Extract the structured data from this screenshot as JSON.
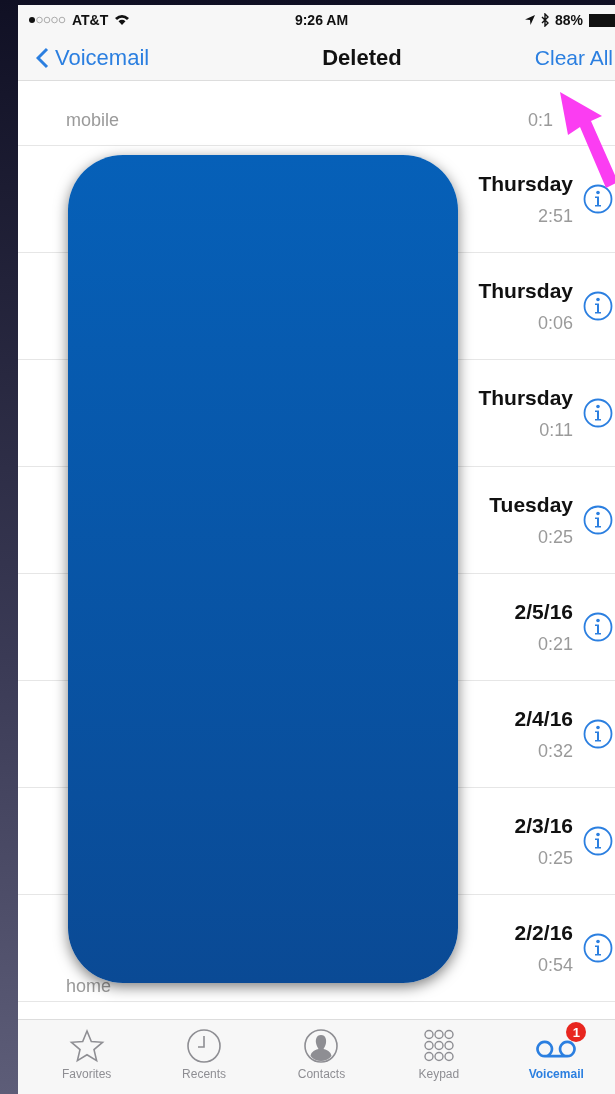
{
  "status_bar": {
    "carrier": "AT&T",
    "time": "9:26 AM",
    "battery": "88%"
  },
  "nav": {
    "back": "Voicemail",
    "title": "Deleted",
    "action": "Clear All"
  },
  "rows": [
    {
      "subtitle": "mobile",
      "duration": "0:1"
    },
    {
      "date": "Thursday",
      "duration": "2:51"
    },
    {
      "date": "Thursday",
      "duration": "0:06"
    },
    {
      "date": "Thursday",
      "duration": "0:11"
    },
    {
      "date": "Tuesday",
      "duration": "0:25"
    },
    {
      "date": "2/5/16",
      "duration": "0:21"
    },
    {
      "date": "2/4/16",
      "duration": "0:32"
    },
    {
      "date": "2/3/16",
      "duration": "0:25"
    },
    {
      "subtitle": "home",
      "date": "2/2/16",
      "duration": "0:54"
    }
  ],
  "tabs": [
    {
      "kind": "star",
      "label": "Favorites",
      "selected": false
    },
    {
      "kind": "clock",
      "label": "Recents",
      "selected": false
    },
    {
      "kind": "person",
      "label": "Contacts",
      "selected": false
    },
    {
      "kind": "keypad",
      "label": "Keypad",
      "selected": false
    },
    {
      "kind": "voicemail",
      "label": "Voicemail",
      "selected": true,
      "badge": "1"
    }
  ]
}
